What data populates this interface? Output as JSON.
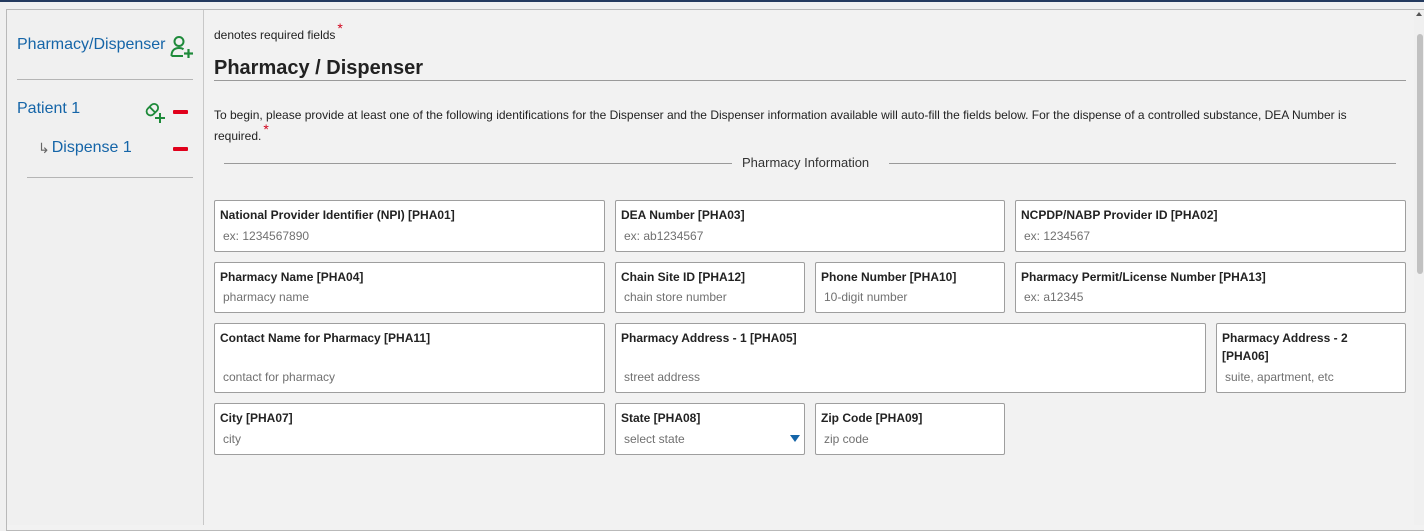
{
  "sidebar": {
    "pharmacy_label": "Pharmacy/Dispenser",
    "patient_label": "Patient 1",
    "dispense_arrow": "↳",
    "dispense_label": "Dispense 1"
  },
  "form": {
    "required_note": "denotes required fields",
    "asterisk": "*",
    "section_title": "Pharmacy / Dispenser",
    "intro": "To begin, please provide at least one of the following identifications for the Dispenser and the Dispenser information available will auto-fill the fields below. For the dispense of a controlled substance, DEA Number is required.",
    "group_legend": "Pharmacy Information",
    "fields": {
      "npi": {
        "label": "National Provider Identifier (NPI) [PHA01]",
        "placeholder": "ex: 1234567890"
      },
      "dea": {
        "label": "DEA Number [PHA03]",
        "placeholder": "ex: ab1234567"
      },
      "ncpdp": {
        "label": "NCPDP/NABP Provider ID [PHA02]",
        "placeholder": "ex: 1234567"
      },
      "pharmacy_name": {
        "label": "Pharmacy Name [PHA04]",
        "placeholder": "pharmacy name"
      },
      "chain_site": {
        "label": "Chain Site ID [PHA12]",
        "placeholder": "chain store number"
      },
      "phone": {
        "label": "Phone Number [PHA10]",
        "placeholder": "10-digit number"
      },
      "permit": {
        "label": "Pharmacy Permit/License Number [PHA13]",
        "placeholder": "ex: a12345"
      },
      "contact": {
        "label": "Contact Name for Pharmacy [PHA11]",
        "placeholder": "contact for pharmacy"
      },
      "address1": {
        "label": "Pharmacy Address - 1 [PHA05]",
        "placeholder": "street address"
      },
      "address2": {
        "label": "Pharmacy Address - 2 [PHA06]",
        "placeholder": "suite, apartment, etc"
      },
      "city": {
        "label": "City [PHA07]",
        "placeholder": "city"
      },
      "state": {
        "label": "State [PHA08]",
        "placeholder": "select state"
      },
      "zip": {
        "label": "Zip Code [PHA09]",
        "placeholder": "zip code"
      }
    }
  },
  "colors": {
    "link": "#1565a8",
    "add_icon": "#1e8a3a",
    "remove": "#e0001b",
    "required": "#d0021b"
  }
}
